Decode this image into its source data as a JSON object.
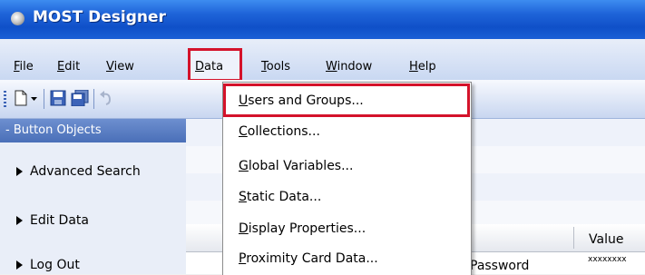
{
  "window": {
    "title": "MOST Designer"
  },
  "menu": {
    "file": {
      "first": "F",
      "rest": "ile"
    },
    "edit": {
      "first": "E",
      "rest": "dit"
    },
    "view": {
      "first": "V",
      "rest": "iew"
    },
    "data": {
      "first": "D",
      "rest": "ata"
    },
    "tools": {
      "first": "T",
      "rest": "ools"
    },
    "window": {
      "first": "W",
      "rest": "indow"
    },
    "help": {
      "first": "H",
      "rest": "elp"
    }
  },
  "toolbar": {
    "icons": [
      "new-document-icon",
      "dropdown-arrow-icon",
      "save-icon",
      "save-all-icon",
      "undo-icon"
    ]
  },
  "left_panel": {
    "header": "- Button Objects",
    "items": [
      "Advanced Search",
      "Edit Data",
      "Log Out"
    ]
  },
  "grid": {
    "column_value": "Value",
    "row_label": "Password",
    "row_value": "xxxxxxxx"
  },
  "data_menu": {
    "items": [
      {
        "first": "U",
        "rest": "sers and Groups..."
      },
      {
        "first": "C",
        "rest": "ollections..."
      },
      {
        "first": "G",
        "rest": "lobal Variables..."
      },
      {
        "first": "S",
        "rest": "tatic Data..."
      },
      {
        "first": "D",
        "rest": "isplay Properties..."
      },
      {
        "first": "P",
        "rest": "roximity Card Data..."
      }
    ]
  },
  "colors": {
    "highlight_border": "#d4122a",
    "title_bar": "#1f64d9"
  }
}
